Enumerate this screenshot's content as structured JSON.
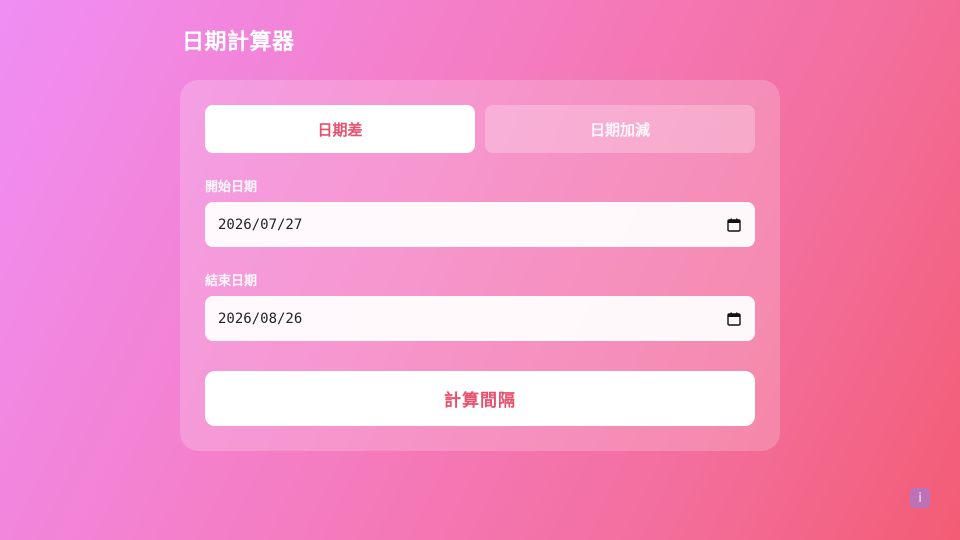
{
  "app": {
    "title": "日期計算器"
  },
  "tabs": [
    {
      "label": "日期差",
      "active": true
    },
    {
      "label": "日期加減",
      "active": false
    }
  ],
  "form": {
    "start_label": "開始日期",
    "start_value": "2026/07/27",
    "end_label": "結束日期",
    "end_value": "2026/08/26",
    "submit_label": "計算間隔"
  },
  "info": {
    "label": "i"
  },
  "icons": {
    "calendar": "calendar-icon",
    "info": "info-icon"
  },
  "colors": {
    "accent": "#e8506e",
    "gradient_start": "#f08ef4",
    "gradient_end": "#f35c74"
  }
}
